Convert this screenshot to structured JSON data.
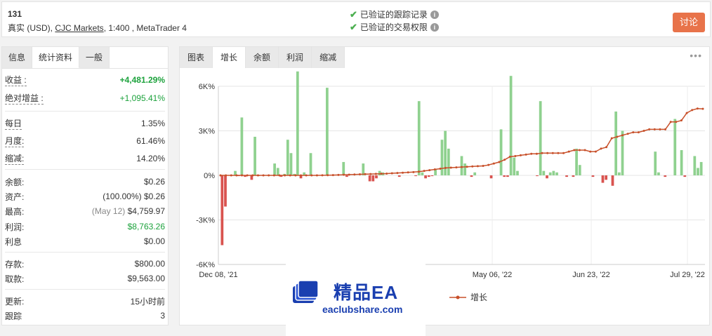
{
  "header": {
    "account_id": "131",
    "desc_prefix": "真实 (USD), ",
    "broker": "CJC Markets",
    "desc_suffix": ", 1:400 , MetaTrader 4",
    "verified_tracking": "已验证的跟踪记录",
    "verified_trading": "已验证的交易权限",
    "discuss_button": "讨论"
  },
  "left_tabs": [
    "信息",
    "统计资料",
    "一般"
  ],
  "stats": {
    "gain_label": "收益 :",
    "gain": "+4,481.29%",
    "abs_gain_label": "绝对增益 :",
    "abs_gain": "+1,095.41%",
    "daily_label": "每日",
    "daily": "1.35%",
    "monthly_label": "月度:",
    "monthly": "61.46%",
    "drawdown_label": "缩减:",
    "drawdown": "14.20%",
    "balance_label": "余额:",
    "balance": "$0.26",
    "equity_label": "资产:",
    "equity": "(100.00%) $0.26",
    "highest_label": "最高:",
    "highest_date": "(May 12)",
    "highest": "$4,759.97",
    "profit_label": "利润:",
    "profit": "$8,763.26",
    "interest_label": "利息",
    "interest": "$0.00",
    "deposits_label": "存款:",
    "deposits": "$800.00",
    "withdrawals_label": "取款:",
    "withdrawals": "$9,563.00",
    "updated_label": "更新:",
    "updated": "15小时前",
    "tracking_label": "跟踪",
    "tracking": "3"
  },
  "right_tabs": [
    "图表",
    "增长",
    "余额",
    "利润",
    "缩减"
  ],
  "more_icon": "more-dots-icon",
  "watermark": {
    "title": "精品EA",
    "url": "eaclubshare.com"
  },
  "colors": {
    "accent": "#e8734a",
    "bar_pos": "#8fd18f",
    "bar_neg": "#d9534f",
    "line": "#c8502a",
    "green_text": "#1ca23c"
  },
  "chart_data": {
    "type": "line",
    "x_ticks": [
      "Dec 08, '21",
      "May 06, '22",
      "Jun 23, '22",
      "Jul 29, '22"
    ],
    "y_ticks": [
      "6K%",
      "3K%",
      "0%",
      "-3K%",
      "-6K%"
    ],
    "ylim": [
      -6000,
      6000
    ],
    "grid": true,
    "legend": [
      "增长"
    ],
    "series": [
      {
        "name": "增长",
        "type": "line",
        "values": [
          0,
          0,
          0,
          0,
          0,
          0,
          0,
          0,
          0,
          0,
          0,
          0,
          0,
          0,
          0,
          0,
          0,
          0,
          0,
          5,
          10,
          20,
          30,
          40,
          50,
          60,
          70,
          80,
          90,
          100,
          110,
          120,
          140,
          160,
          180,
          200,
          220,
          250,
          300,
          350,
          400,
          450,
          500,
          520,
          540,
          560,
          580,
          600,
          620,
          640,
          700,
          800,
          900,
          1050,
          1250,
          1300,
          1350,
          1400,
          1450,
          1450,
          1500,
          1500,
          1500,
          1500,
          1500,
          1600,
          1700,
          1700,
          1700,
          1600,
          1600,
          1800,
          1900,
          2500,
          2600,
          2700,
          2800,
          2900,
          2900,
          3000,
          3100,
          3100,
          3100,
          3100,
          3600,
          3600,
          3700,
          4200,
          4400,
          4500,
          4481
        ]
      },
      {
        "type": "bar",
        "values": [
          -4700,
          -2100,
          0,
          0,
          300,
          -50,
          3900,
          -100,
          0,
          -300,
          2600,
          -50,
          0,
          0,
          0,
          0,
          800,
          500,
          -100,
          100,
          2400,
          1500,
          100,
          7000,
          -200,
          200,
          0,
          1500,
          0,
          0,
          0,
          0,
          5900,
          0,
          0,
          0,
          0,
          900,
          -100,
          0,
          0,
          0,
          0,
          800,
          0,
          -400,
          -400,
          -200,
          300,
          200,
          0,
          0,
          0,
          0,
          -100,
          0,
          0,
          0,
          0,
          -50,
          5000,
          200,
          -200,
          -100,
          -50,
          400,
          0,
          2400,
          3000,
          1800,
          0,
          0,
          0,
          1300,
          800,
          0,
          -100,
          200,
          0,
          0,
          0,
          0,
          -200,
          0,
          0,
          3100,
          -100,
          -100,
          6700,
          1200,
          300,
          0,
          0,
          0,
          0,
          0,
          -50,
          5000,
          300,
          -200,
          200,
          300,
          200,
          0,
          0,
          -100,
          0,
          -100,
          1800,
          700,
          0,
          0,
          0,
          -100,
          0,
          0,
          -500,
          -300,
          0,
          -700,
          4300,
          200,
          3000,
          0,
          0,
          0,
          0,
          0,
          0,
          0,
          0,
          0,
          1600,
          200,
          0,
          -100,
          0,
          0,
          3800,
          0,
          1700,
          -100,
          0,
          0,
          1300,
          500,
          900
        ]
      }
    ]
  }
}
